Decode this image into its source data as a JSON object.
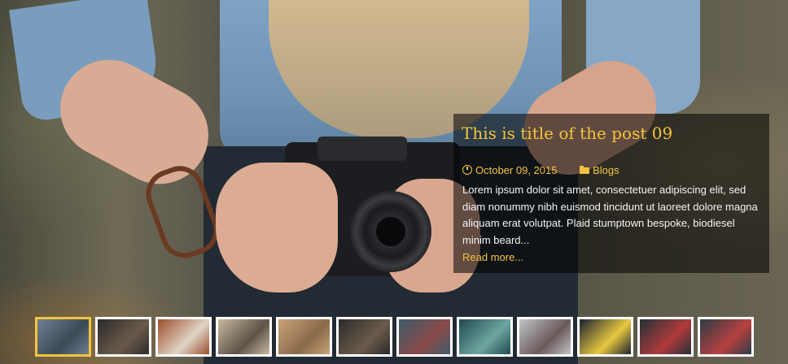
{
  "slide": {
    "title": "This is title of the post 09",
    "date": "October 09, 2015",
    "category": "Blogs",
    "excerpt": "Lorem ipsum dolor sit amet, consectetuer adipiscing elit, sed diam nonummy nibh euismod tincidunt ut laoreet dolore magna aliquam erat volutpat. Plaid stumptown bespoke, biodiesel minim beard...",
    "read_more": "Read more...",
    "icons": {
      "date": "clock-icon",
      "category": "folder-icon"
    }
  },
  "thumbnails": [
    {
      "subject": "camera-photographer",
      "colors": [
        "#6e7f93",
        "#3c4a56"
      ],
      "active": true
    },
    {
      "subject": "woman-with-camera",
      "colors": [
        "#2b2b2b",
        "#6b5a4a"
      ],
      "active": false
    },
    {
      "subject": "brick-wall",
      "colors": [
        "#9b4e2c",
        "#e0d4c4"
      ],
      "active": false
    },
    {
      "subject": "forest-person",
      "colors": [
        "#c9b8a0",
        "#5c5448"
      ],
      "active": false
    },
    {
      "subject": "meadow-deer",
      "colors": [
        "#c9a37a",
        "#8a6a4a"
      ],
      "active": false
    },
    {
      "subject": "woman-with-camera",
      "colors": [
        "#2b2b2b",
        "#6b5a4a"
      ],
      "active": false
    },
    {
      "subject": "crowd",
      "colors": [
        "#3c5c6a",
        "#8a4a4a"
      ],
      "active": false
    },
    {
      "subject": "photographer-teal",
      "colors": [
        "#1f4a50",
        "#6fa5a0"
      ],
      "active": false
    },
    {
      "subject": "street-winter",
      "colors": [
        "#c0c4c8",
        "#6a5a5a"
      ],
      "active": false
    },
    {
      "subject": "flowers-flatlay",
      "colors": [
        "#1a2130",
        "#e8c840"
      ],
      "active": false
    },
    {
      "subject": "red-hat-camera",
      "colors": [
        "#223238",
        "#b03a3a"
      ],
      "active": false
    },
    {
      "subject": "red-hat-camera-2",
      "colors": [
        "#2a3d44",
        "#b84040"
      ],
      "active": false
    }
  ],
  "accent_color": "#f2c43e"
}
